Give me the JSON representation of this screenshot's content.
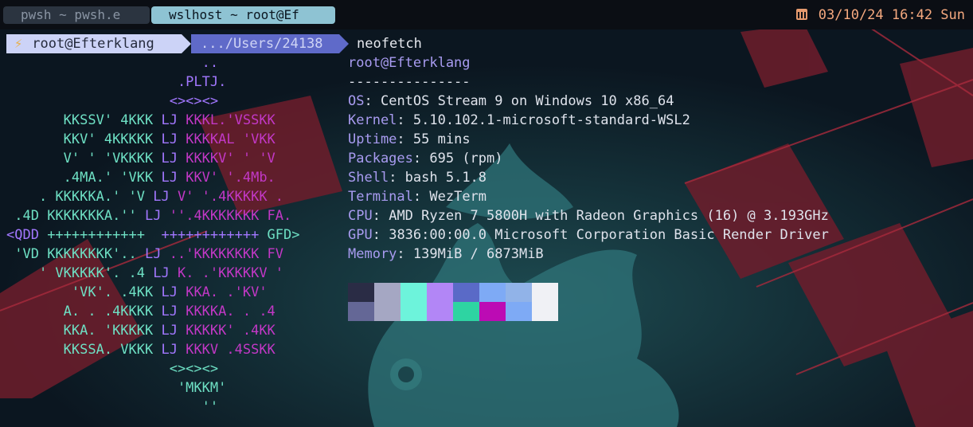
{
  "tabs": [
    {
      "label": "pwsh ~ pwsh.e",
      "active": false
    },
    {
      "label": "wslhost ~ root@Ef",
      "active": true
    }
  ],
  "status": {
    "datetime": "03/10/24 16:42 Sun"
  },
  "prompt": {
    "user_host": "root@Efterklang",
    "path": ".../Users/24138",
    "command": "neofetch"
  },
  "ascii_logo": [
    [
      [
        "..",
        "c2"
      ]
    ],
    [
      [
        ".PLTJ.",
        "c2"
      ]
    ],
    [
      [
        "<><><>",
        "c2"
      ]
    ],
    [
      [
        "KKSSV' 4KKK ",
        "c1"
      ],
      [
        "LJ ",
        "c2"
      ],
      [
        "KKKL.'VSSKK",
        "c3"
      ]
    ],
    [
      [
        "KKV' 4KKKKK ",
        "c1"
      ],
      [
        "LJ ",
        "c2"
      ],
      [
        "KKKKAL 'VKK",
        "c3"
      ]
    ],
    [
      [
        "V' ' 'VKKKK ",
        "c1"
      ],
      [
        "LJ ",
        "c2"
      ],
      [
        "KKKKV' ' 'V",
        "c3"
      ]
    ],
    [
      [
        ".4MA.' 'VKK ",
        "c1"
      ],
      [
        "LJ ",
        "c2"
      ],
      [
        "KKV' '.4Mb.",
        "c3"
      ]
    ],
    [
      [
        ". KKKKKA.' 'V ",
        "c1"
      ],
      [
        "LJ ",
        "c2"
      ],
      [
        "V' '.4KKKKK .",
        "c3"
      ]
    ],
    [
      [
        ".4D KKKKKKKA.'' ",
        "c1"
      ],
      [
        "LJ ",
        "c2"
      ],
      [
        "''.4KKKKKKK FA.",
        "c3"
      ]
    ],
    [
      [
        "<QDD ",
        "c2"
      ],
      [
        "++++++++++++  ",
        "c1"
      ],
      [
        "++++++++++++ ",
        "c2"
      ],
      [
        "GFD>",
        "c1"
      ]
    ],
    [
      [
        "'VD KKKKKKKK'.. ",
        "c1"
      ],
      [
        "LJ ",
        "c2"
      ],
      [
        "..'KKKKKKKK FV",
        "c3"
      ]
    ],
    [
      [
        "' VKKKKK'. .4 ",
        "c1"
      ],
      [
        "LJ ",
        "c2"
      ],
      [
        "K. .'KKKKKV '",
        "c3"
      ]
    ],
    [
      [
        "'VK'. .4KK ",
        "c1"
      ],
      [
        "LJ ",
        "c2"
      ],
      [
        "KKA. .'KV'",
        "c3"
      ]
    ],
    [
      [
        "A. . .4KKKK ",
        "c1"
      ],
      [
        "LJ ",
        "c2"
      ],
      [
        "KKKKA. . .4",
        "c3"
      ]
    ],
    [
      [
        "KKA. 'KKKKK ",
        "c1"
      ],
      [
        "LJ ",
        "c2"
      ],
      [
        "KKKKK' .4KK",
        "c3"
      ]
    ],
    [
      [
        "KKSSA. VKKK ",
        "c1"
      ],
      [
        "LJ ",
        "c2"
      ],
      [
        "KKKV .4SSKK",
        "c3"
      ]
    ],
    [
      [
        "<><><>",
        "c1"
      ]
    ],
    [
      [
        "'MKKM'",
        "c1"
      ]
    ],
    [
      [
        "''",
        "c1"
      ]
    ]
  ],
  "ascii_indent": [
    24,
    21,
    20,
    7,
    7,
    7,
    7,
    4,
    1,
    0,
    1,
    4,
    8,
    7,
    7,
    7,
    20,
    21,
    24
  ],
  "info": {
    "user": "root@Efterklang",
    "separator": "---------------",
    "fields": [
      {
        "key": "OS",
        "value": "CentOS Stream 9 on Windows 10 x86_64"
      },
      {
        "key": "Kernel",
        "value": "5.10.102.1-microsoft-standard-WSL2"
      },
      {
        "key": "Uptime",
        "value": "55 mins"
      },
      {
        "key": "Packages",
        "value": "695 (rpm)"
      },
      {
        "key": "Shell",
        "value": "bash 5.1.8"
      },
      {
        "key": "Terminal",
        "value": "WezTerm"
      },
      {
        "key": "CPU",
        "value": "AMD Ryzen 7 5800H with Radeon Graphics (16) @ 3.193GHz"
      },
      {
        "key": "GPU",
        "value": "3836:00:00.0 Microsoft Corporation Basic Render Driver"
      },
      {
        "key": "Memory",
        "value": "139MiB / 6873MiB"
      }
    ]
  },
  "palette": [
    [
      "#2a2c45",
      "#a5a7c3",
      "#6df3db",
      "#b286f6",
      "#5a6ac7",
      "#7eaaf5",
      "#91b3e8",
      "#f0f1f5"
    ],
    [
      "#646796",
      "#a5a7c3",
      "#6df3db",
      "#b286f6",
      "#2ed4a2",
      "#bc0bb4",
      "#7eaaf5",
      "#f0f1f5"
    ]
  ]
}
